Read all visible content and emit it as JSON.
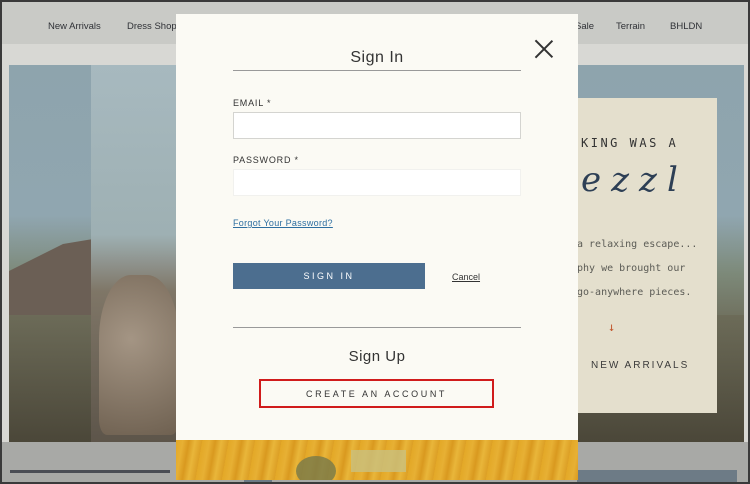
{
  "nav": {
    "items_left": [
      "New Arrivals",
      "Dress Shop"
    ],
    "items_right": [
      "Sale",
      "Terrain",
      "BHLDN"
    ]
  },
  "promo": {
    "heading": "KING WAS A",
    "script": "ezzl",
    "line1": "a relaxing escape...",
    "line2": "phy we brought our",
    "line3": "go-anywhere pieces.",
    "arrow": "↓",
    "link": "NEW ARRIVALS"
  },
  "modal": {
    "signin_title": "Sign In",
    "email_label": "EMAIL *",
    "email_value": "",
    "password_label": "PASSWORD *",
    "password_value": "",
    "forgot_link": "Forgot Your Password?",
    "signin_button": "SIGN IN",
    "cancel_link": "Cancel",
    "signup_title": "Sign Up",
    "create_button": "CREATE AN ACCOUNT"
  },
  "colors": {
    "primary_button": "#4c6e8f",
    "highlight_border": "#d01b1b",
    "modal_bg": "#fbfaf4"
  }
}
